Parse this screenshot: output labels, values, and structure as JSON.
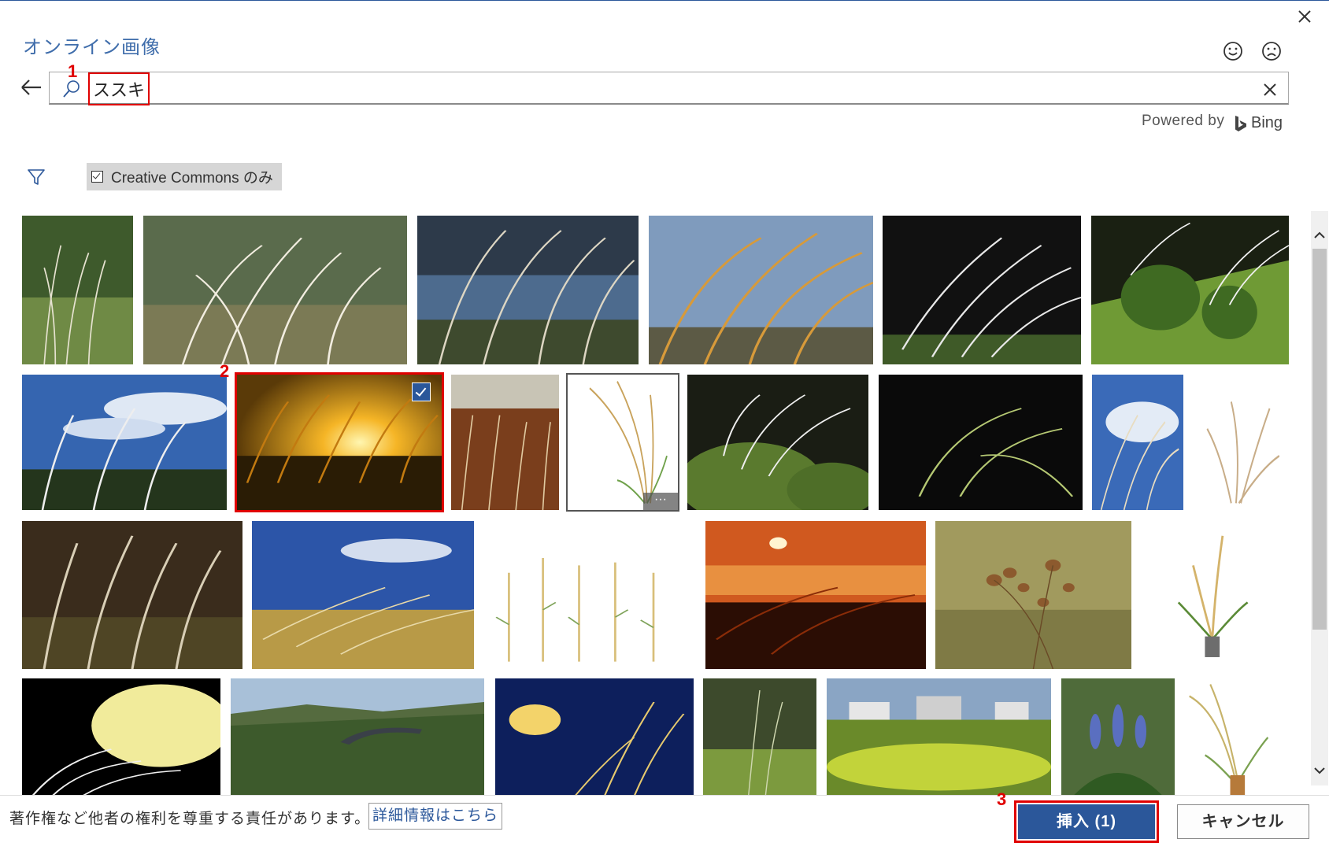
{
  "dialog": {
    "title": "オンライン画像",
    "close_icon": "close-icon",
    "feedback": {
      "smile_icon": "smile-icon",
      "frown_icon": "frown-icon"
    }
  },
  "search": {
    "value": "ススキ",
    "back_icon": "back-arrow-icon",
    "search_icon": "search-icon",
    "clear_icon": "clear-icon"
  },
  "powered_by": {
    "label": "Powered by",
    "brand": "Bing"
  },
  "filter": {
    "filter_icon": "filter-icon",
    "creative_commons_label": "Creative Commons のみ",
    "creative_commons_checked": true
  },
  "annotations": {
    "step1": "1",
    "step2": "2",
    "step3": "3"
  },
  "results": {
    "selected_index": 7,
    "selected_count": 1
  },
  "footer": {
    "notice": "著作権など他者の権利を尊重する責任があります。",
    "more_info_link": "詳細情報はこちら",
    "insert_button": "挿入 (1)",
    "cancel_button": "キャンセル"
  },
  "colors": {
    "accent": "#2b579a",
    "title": "#3f6dab",
    "annotation": "#e00000"
  }
}
